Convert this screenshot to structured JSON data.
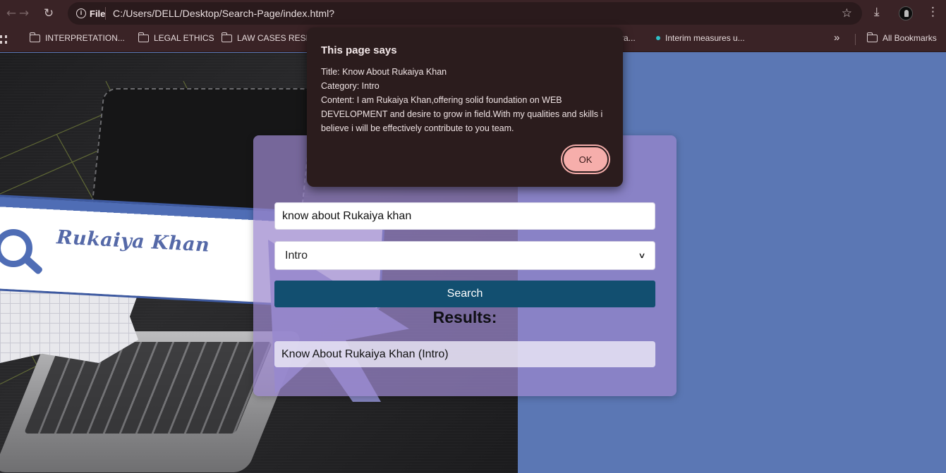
{
  "browser": {
    "site_chip": "File",
    "url": "C:/Users/DELL/Desktop/Search-Page/index.html?",
    "icons": {
      "back": "arrow-left-icon",
      "forward": "arrow-right-icon",
      "reload": "reload-icon",
      "info": "info-icon",
      "star": "star-icon",
      "download": "download-icon",
      "menu": "kebab-menu-icon"
    }
  },
  "bookmarks": {
    "items": [
      {
        "label": "INTERPRETATION...",
        "icon": "folder-icon"
      },
      {
        "label": "LEGAL ETHICS",
        "icon": "folder-icon"
      },
      {
        "label": "LAW CASES RESEA",
        "icon": "folder-icon"
      },
      {
        "label": "itra...",
        "icon": "page-icon"
      },
      {
        "label": "Interim measures u...",
        "icon": "dot-icon"
      }
    ],
    "overflow": "»",
    "all_bookmarks": "All Bookmarks"
  },
  "page": {
    "logo_text": "Rukaiya Khan",
    "search_value": "know about Rukaiya khan",
    "category_selected": "Intro",
    "search_button": "Search",
    "results_title": "Results:",
    "results": [
      {
        "text": "Know About Rukaiya Khan (Intro)"
      }
    ]
  },
  "alert": {
    "title": "This page says",
    "lines": [
      "Title: Know About Rukaiya Khan",
      "Category: Intro",
      "Content: I am Rukaiya Khan,offering solid foundation on WEB DEVELOPMENT and desire to grow in field.With my qualities and skills i believe i will be effectively contribute to you team."
    ],
    "ok_label": "OK"
  },
  "colors": {
    "chrome": "#3a2326",
    "page_blue": "#5b77b4",
    "button": "#124f70",
    "ok": "#f6aeab"
  }
}
